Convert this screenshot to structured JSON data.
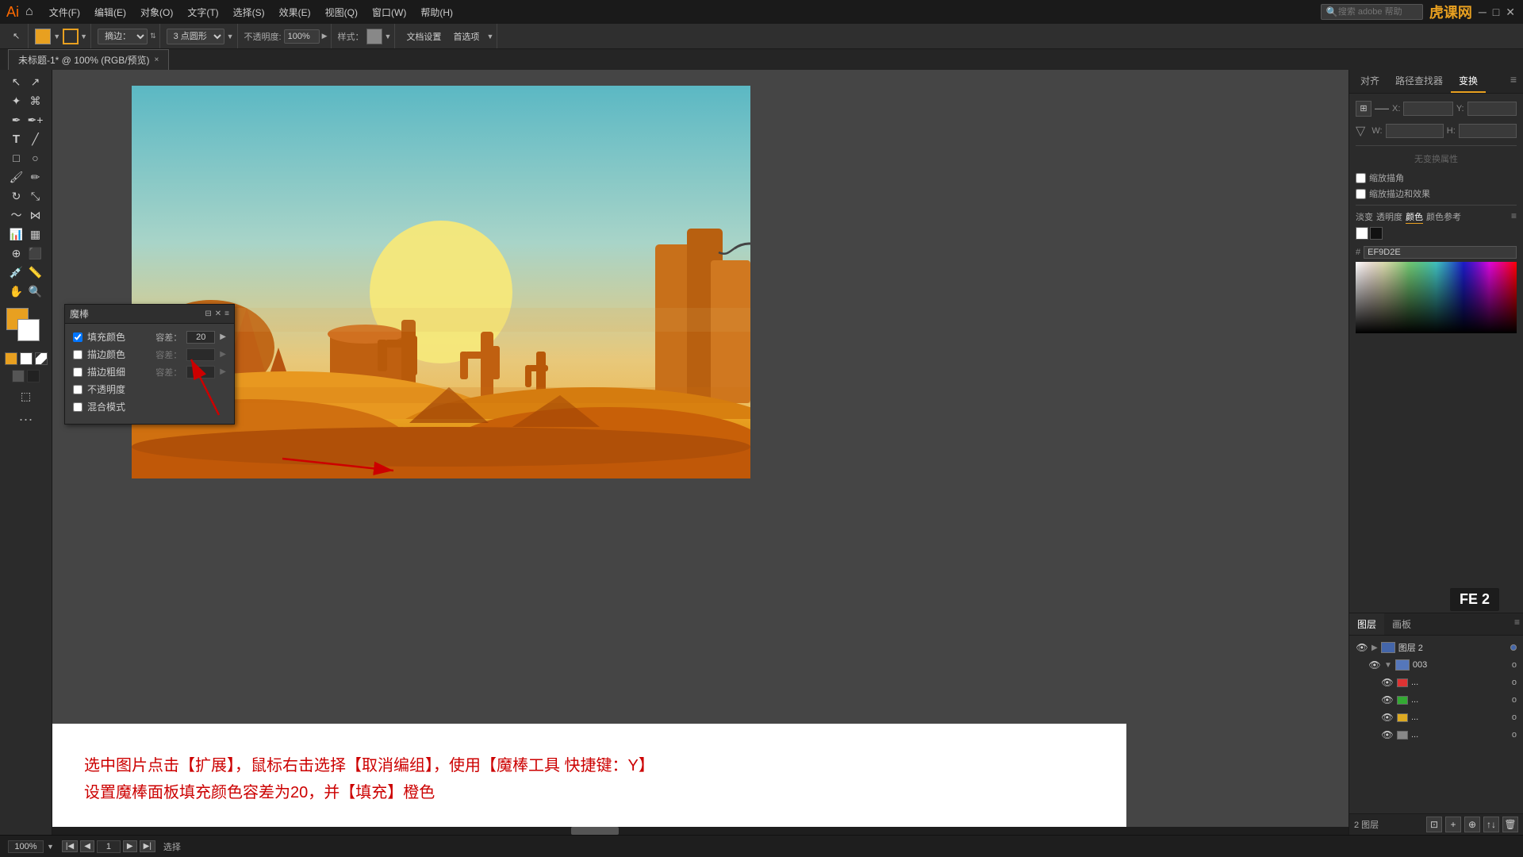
{
  "app": {
    "title": "Adobe Illustrator",
    "icon": "Ai"
  },
  "menubar": {
    "items": [
      "文件(F)",
      "编辑(E)",
      "对象(O)",
      "文字(T)",
      "选择(S)",
      "效果(E)",
      "视图(Q)",
      "窗口(W)",
      "帮助(H)"
    ],
    "search_placeholder": "搜索 adobe 帮助"
  },
  "toolbar": {
    "fill_label": "填充:",
    "stroke_label": "描边:",
    "brush_select": "摘边：",
    "point_label": "3 点圆形",
    "opacity_label": "不透明度:",
    "opacity_value": "100%",
    "style_label": "样式：",
    "doc_settings": "文档设置",
    "preferences": "首选项"
  },
  "tab": {
    "title": "未标题-1* @ 100% (RGB/预览)",
    "close": "×"
  },
  "magic_wand_panel": {
    "title": "魔棒",
    "fill_color_label": "填充颜色",
    "fill_color_checked": true,
    "fill_tolerance": "20",
    "stroke_color_label": "描边颜色",
    "stroke_color_checked": false,
    "stroke_tolerance_label": "容差：",
    "stroke_size_label": "描边粗细",
    "stroke_size_checked": false,
    "stroke_size_tolerance_label": "容差：",
    "opacity_label": "不透明度",
    "opacity_checked": false,
    "blend_mode_label": "混合模式",
    "blend_mode_checked": false
  },
  "instructions": {
    "line1": "选中图片点击【扩展】，鼠标右击选择【取消编组】，使用【魔棒工具 快捷键：Y】",
    "line2": "设置魔棒面板填充颜色容差为20，并【填充】橙色"
  },
  "right_panel": {
    "tabs": [
      "对齐",
      "路径查找器",
      "变换"
    ],
    "active_tab": "变换",
    "transform": {
      "x_label": "X:",
      "x_value": "",
      "y_label": "Y:",
      "y_value": "",
      "w_label": "W:",
      "w_value": "",
      "h_label": "H:",
      "h_value": ""
    },
    "hex_label": "#",
    "hex_value": "EF9D2E",
    "no_selection": "无变换属性",
    "checkbox1": "缩放描角",
    "checkbox2": "缩放描边和效果",
    "tabs2": [
      "淡变",
      "透明度",
      "颜色",
      "颜色参考"
    ]
  },
  "layers_panel": {
    "tabs": [
      "图层",
      "画板"
    ],
    "active_tab": "图层",
    "items": [
      {
        "name": "图层 2",
        "expanded": true,
        "color": "blue",
        "visible": true
      },
      {
        "name": "003",
        "expanded": false,
        "color": "blue",
        "visible": true
      },
      {
        "name": "...",
        "color": "red",
        "visible": true
      },
      {
        "name": "...",
        "color": "green",
        "visible": true
      },
      {
        "name": "...",
        "color": "yellow",
        "visible": true
      },
      {
        "name": "...",
        "color": "gray",
        "visible": true
      }
    ],
    "footer_text": "2 图层"
  },
  "status_bar": {
    "zoom": "100%",
    "zoom_select": "100",
    "page_nav": "1",
    "status_label": "选择",
    "watermark": "FE 2"
  }
}
